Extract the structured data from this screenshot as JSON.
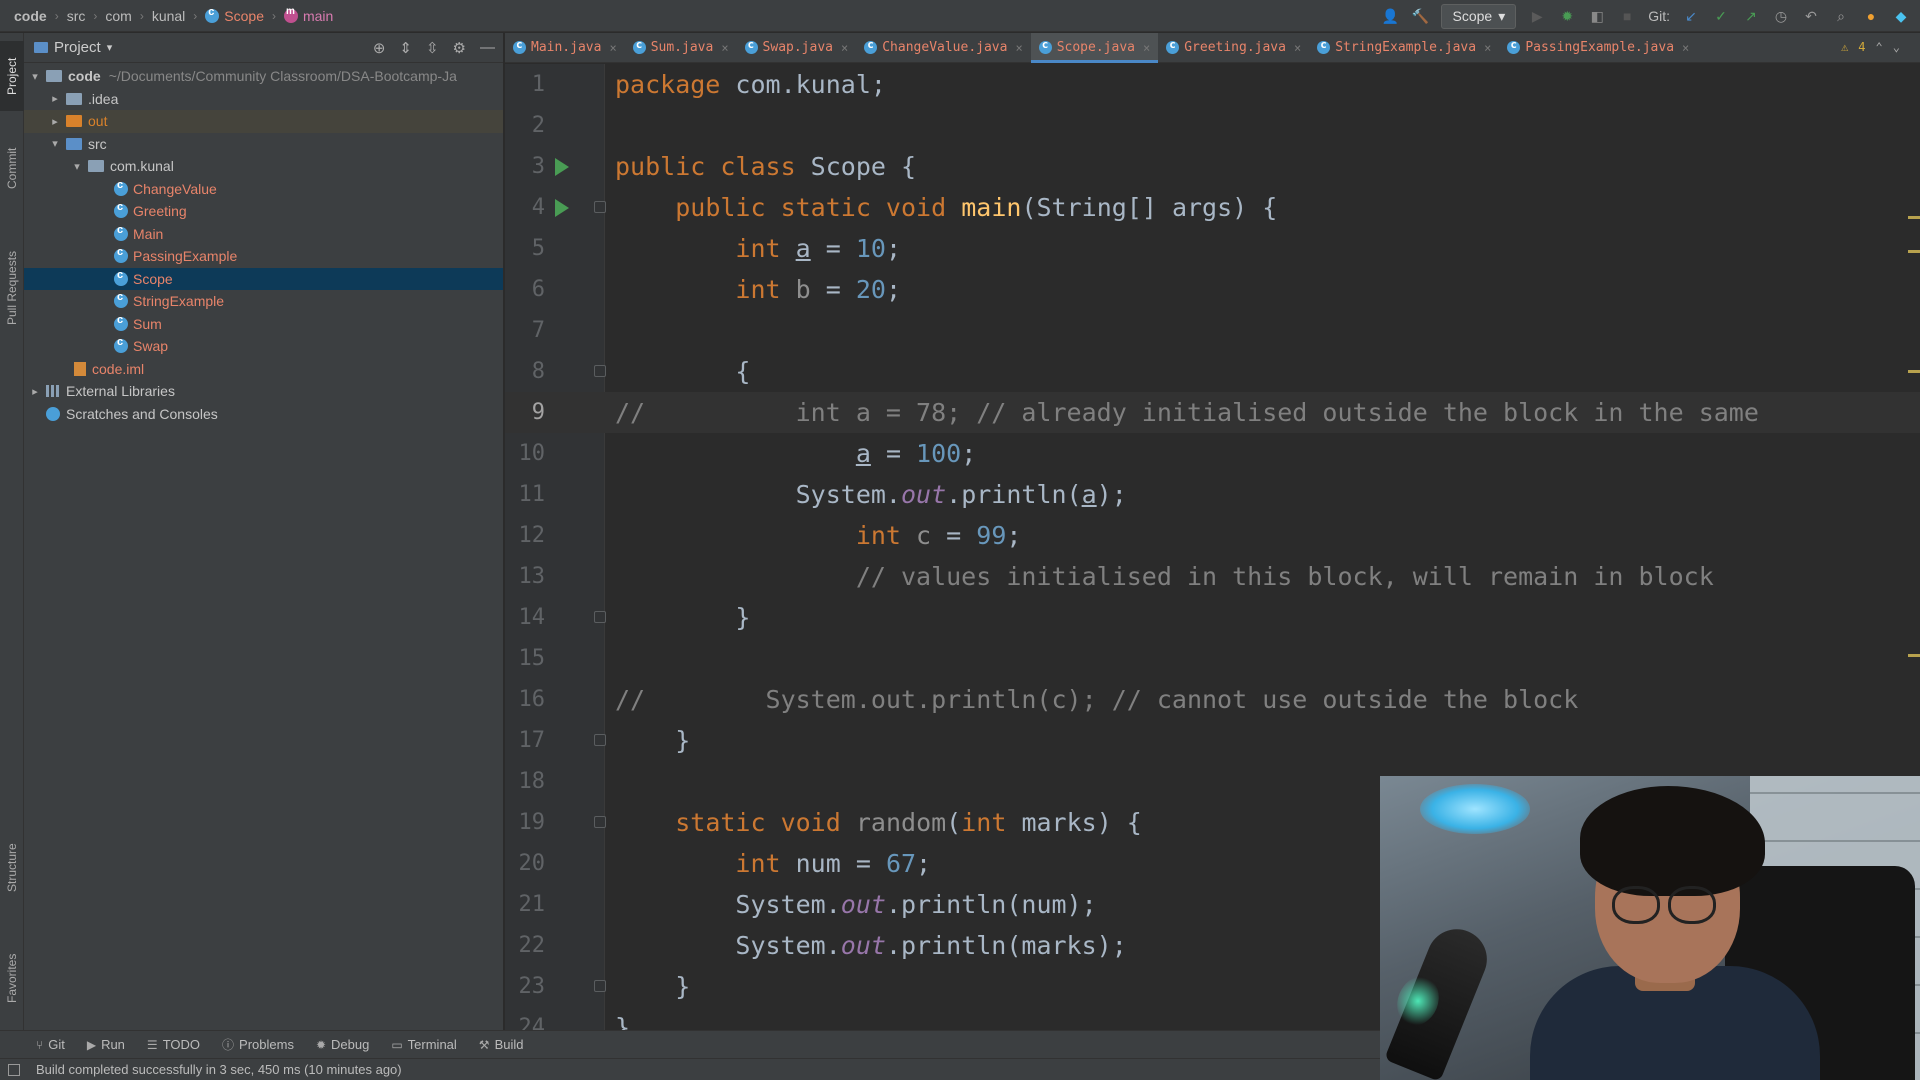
{
  "navbar": {
    "crumbs": [
      "code",
      "src",
      "com",
      "kunal",
      "Scope",
      "main"
    ],
    "run_config": "Scope",
    "git_label": "Git:"
  },
  "left_strip": {
    "tabs": [
      "Project",
      "Commit",
      "Pull Requests",
      "Structure",
      "Favorites"
    ]
  },
  "project": {
    "title": "Project",
    "tree": [
      {
        "label": "code",
        "path": "~/Documents/Community Classroom/DSA-Bootcamp-Ja"
      },
      {
        "label": ".idea"
      },
      {
        "label": "out"
      },
      {
        "label": "src"
      },
      {
        "label": "com.kunal"
      },
      {
        "label": "ChangeValue"
      },
      {
        "label": "Greeting"
      },
      {
        "label": "Main"
      },
      {
        "label": "PassingExample"
      },
      {
        "label": "Scope"
      },
      {
        "label": "StringExample"
      },
      {
        "label": "Sum"
      },
      {
        "label": "Swap"
      },
      {
        "label": "code.iml"
      },
      {
        "label": "External Libraries"
      },
      {
        "label": "Scratches and Consoles"
      }
    ]
  },
  "tabs": [
    "Main.java",
    "Sum.java",
    "Swap.java",
    "ChangeValue.java",
    "Scope.java",
    "Greeting.java",
    "StringExample.java",
    "PassingExample.java"
  ],
  "active_tab": "Scope.java",
  "warnings_count": "4",
  "editor": {
    "line_numbers": [
      "1",
      "2",
      "3",
      "4",
      "5",
      "6",
      "7",
      "8",
      "9",
      "10",
      "11",
      "12",
      "13",
      "14",
      "15",
      "16",
      "17",
      "18",
      "19",
      "20",
      "21",
      "22",
      "23",
      "24"
    ],
    "current_line": "9"
  },
  "toolbar": {
    "items": [
      "Git",
      "Run",
      "TODO",
      "Problems",
      "Debug",
      "Terminal",
      "Build"
    ]
  },
  "status": {
    "message": "Build completed successfully in 3 sec, 450 ms (10 minutes ago)"
  },
  "colors": {
    "keyword": "#cc7832",
    "function": "#ffc66d",
    "number": "#6897bb",
    "comment": "#808080",
    "field": "#9876aa",
    "selection": "#0d3a58",
    "accent_tab": "#4a88c7"
  },
  "icons": [
    "class-icon",
    "method-icon",
    "run-icon",
    "debug-icon",
    "search-icon",
    "update-icon",
    "gear-icon",
    "folder-icon",
    "chevron-right-icon",
    "chevron-down-icon",
    "warning-icon",
    "close-icon"
  ]
}
